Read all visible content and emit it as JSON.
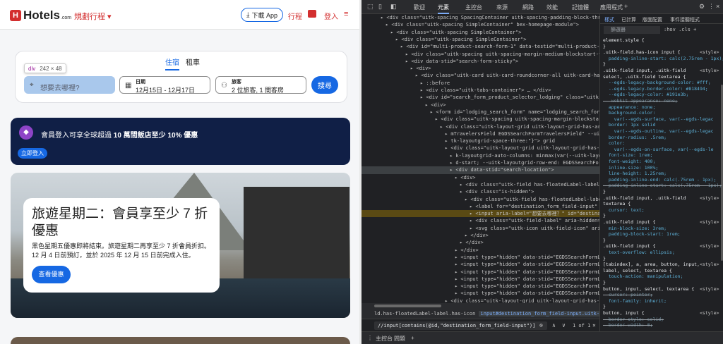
{
  "site": {
    "logo_mark": "H",
    "logo_text": "Hotels",
    "logo_suffix": ".com",
    "trip_label": "規劃行程 ▾",
    "app_button": "下載 App",
    "nav_trips": "行程",
    "nav_login": "登入",
    "tabs": [
      "住宿",
      "租車"
    ],
    "tooltip": {
      "tag": "div",
      "dims": "242 × 48"
    },
    "destination": {
      "placeholder": "想要去哪裡?"
    },
    "dates": {
      "label": "日期",
      "value": "12月15日 - 12月17日"
    },
    "travelers": {
      "label": "旅客",
      "value": "2 位旅客, 1 間客房"
    },
    "search_button": "搜尋",
    "promo": {
      "text_before": "會員登入可享全球超過 ",
      "bold1": "10 萬間飯店至少 10% 優惠",
      "button": "立即登入"
    },
    "hero": {
      "title": "旅遊星期二：會員享至少 7 折優惠",
      "description": "黑色星期五優惠即將結束。旅遊星期二再享至少 7 折會員折扣。12 月 4 日前預訂，並於 2025 年 12 月 15 日前完成入住。",
      "button": "查看優惠"
    }
  },
  "devtools": {
    "tabs": [
      "歡迎",
      "元素",
      "主控台",
      "來源",
      "網路",
      "效能",
      "記憶體",
      "應用程式"
    ],
    "active_tab": "元素",
    "elements": [
      {
        "i": 5,
        "t": "<div class=\"uitk-spacing SpacingContainer uitk-spacing-padding-block-three uitk"
      },
      {
        "i": 6,
        "t": "<div class=\"uitk-spacing SimpleContainer\" bex-homepage-module\">"
      },
      {
        "i": 7,
        "t": "<div class=\"uitk-spacing SimpleContainer\">"
      },
      {
        "i": 8,
        "t": "<div class=\"uitk-spacing SimpleContainer\">"
      },
      {
        "i": 9,
        "t": "<div id=\"multi-product-search-form-1\" data-testid=\"multi-product-search"
      },
      {
        "i": 10,
        "t": "<div class=\"uitk-spacing uitk-spacing-margin-medium-blockstart-twelve"
      },
      {
        "i": 10,
        "t": "<div data-stid=\"search-form-sticky\">"
      },
      {
        "i": 11,
        "t": "<div>"
      },
      {
        "i": 12,
        "t": "<div class=\"uitk-card uitk-card-roundcorner-all uitk-card-has-bo"
      },
      {
        "i": 13,
        "t": "::before"
      },
      {
        "i": 13,
        "t": "<div class=\"uitk-tabs-container\"> … </div>"
      },
      {
        "i": 13,
        "t": "<div id=\"search_form_product_selector_lodging\" class=\"uitk-spa"
      },
      {
        "i": 14,
        "t": "<div>"
      },
      {
        "i": 15,
        "t": "<form id=\"lodging_search_form\" name=\"lodging_search_form\" …"
      },
      {
        "i": 16,
        "t": "<div class=\"uitk-spacing uitk-spacing-margin-blockstart-"
      },
      {
        "i": 17,
        "t": "<div class=\"uitk-layout-grid uitk-layout-grid-has-areas"
      },
      {
        "i": 18,
        "t": "mTravelersField EGDSSearchFormTravelersField\" --uitk-layoutgr"
      },
      {
        "i": 18,
        "t": "tk-layoutgrid-space-three:\"}\"> grid"
      },
      {
        "i": 18,
        "t": "<div class=\"uitk-layout-grid uitk-layout-grid-has-aut"
      },
      {
        "i": 19,
        "t": "k-layoutgrid-auto-columns: minmax(var(--uitk-layoutgr"
      },
      {
        "i": 19,
        "t": "d-start; --uitk-layoutgrid-row-end: EGDSSearchFormLoca"
      },
      {
        "i": 19,
        "t": "<div data-stid=\"search-location\">",
        "sel": true
      },
      {
        "i": 20,
        "t": "<div>"
      },
      {
        "i": 21,
        "t": "<div class=\"uitk-field has-floatedLabel-label has"
      },
      {
        "i": 21,
        "t": "<div class=\"is-hidden\">"
      },
      {
        "i": 22,
        "t": "<div class=\"uitk-field has-floatedLabel-label"
      },
      {
        "i": 23,
        "t": "<label for=\"destination_form_field-input\" cl"
      },
      {
        "i": 23,
        "t": "<input aria-label=\"想要去哪裡？\" id=\"destinati",
        "hl": true
      },
      {
        "i": 23,
        "t": "<div class=\"uitk-field-label\" aria-hidden=\"tr"
      },
      {
        "i": 23,
        "t": "<svg class=\"uitk-icon uitk-field-icon\" aria-"
      },
      {
        "i": 22,
        "t": "</div>"
      },
      {
        "i": 21,
        "t": "</div>"
      },
      {
        "i": 20,
        "t": "</div>"
      },
      {
        "i": 20,
        "t": "<input type=\"hidden\" data-stid=\"EGDSSearchFormLocati"
      },
      {
        "i": 20,
        "t": "<input type=\"hidden\" data-stid=\"EGDSSearchFormLocati"
      },
      {
        "i": 20,
        "t": "<input type=\"hidden\" data-stid=\"EGDSSearchFormLocati"
      },
      {
        "i": 20,
        "t": "<input type=\"hidden\" data-stid=\"EGDSSearchFormLocati"
      },
      {
        "i": 20,
        "t": "<input type=\"hidden\" data-stid=\"EGDSSearchFormLocati"
      },
      {
        "i": 20,
        "t": "<input type=\"hidden\" data-stid=\"EGDSSearchFormLocati"
      },
      {
        "i": 18,
        "t": "<div class=\"uitk-layout-grid uitk-layout-grid-has-aut"
      },
      {
        "i": 19,
        "t": "k-layoutgrid-auto-columns: minmax(var(--uitk-layoutgr"
      },
      {
        "i": 19,
        "t": "erField-start; --uitk-layoutgrid-row-end: EGDSSearchFo"
      },
      {
        "i": 18,
        "t": "<div class=\"uitk-layout-grid uitk-layout-grid-has-aut"
      }
    ],
    "breadcrumbs": {
      "a": "ld.has-floatedLabel-label.has-icon",
      "b": "input#destination_form_field-input.uitk-field-input.empty-placeholder"
    },
    "find": {
      "query": "//input[contains(@id,\"destination_form_field-input\")]",
      "count": "1 of 1"
    },
    "drawer_tabs": [
      "主控台",
      "問題"
    ],
    "styles_tabs": [
      "樣式",
      "已計算",
      "版面配置",
      "事件接聽程式"
    ],
    "filter_placeholder": "篩選器",
    "filter_tools": ":hov .cls +",
    "styles": [
      {
        "t": "element.style {",
        "k": "sel"
      },
      {
        "t": "}",
        "k": "sel"
      },
      {
        "t": ".uitk-field.has-icon input {",
        "k": "sel",
        "src": "<style>"
      },
      {
        "t": "  padding-inline-start: calc(2.75rem - 1px);",
        "k": "prop"
      },
      {
        "t": "}",
        "k": "sel"
      },
      {
        "t": ".uitk-field input, .uitk-field",
        "k": "sel",
        "src": "<style>"
      },
      {
        "t": "select, .uitk-field textarea {",
        "k": "sel"
      },
      {
        "t": "  --egds-legacy-background-color: #fff;",
        "k": "prop"
      },
      {
        "t": "  --egds-legacy-border-color: #818494;",
        "k": "prop"
      },
      {
        "t": "  --egds-legacy-color: #191e3b;",
        "k": "prop"
      },
      {
        "t": "  -webkit-appearance: none;",
        "k": "strike"
      },
      {
        "t": "  appearance: none;",
        "k": "prop"
      },
      {
        "t": "  background-color:",
        "k": "prop"
      },
      {
        "t": "    var(--egds-surface, var(--egds-legac",
        "k": "prop"
      },
      {
        "t": "  border: 1px solid",
        "k": "prop"
      },
      {
        "t": "    var(--egds-outline, var(--egds-legac",
        "k": "prop"
      },
      {
        "t": "  border-radius: .5rem;",
        "k": "prop"
      },
      {
        "t": "  color:",
        "k": "prop"
      },
      {
        "t": "    var(--egds-on-surface, var(--egds-le",
        "k": "prop"
      },
      {
        "t": "  font-size: 1rem;",
        "k": "prop"
      },
      {
        "t": "  font-weight: 400;",
        "k": "prop"
      },
      {
        "t": "  inline-size: 100%;",
        "k": "prop"
      },
      {
        "t": "  line-height: 1.25rem;",
        "k": "prop"
      },
      {
        "t": "  padding-inline-end: calc(.75rem - 1px);",
        "k": "prop"
      },
      {
        "t": "  padding-inline-start: calc(.75rem - 1px);",
        "k": "strike"
      },
      {
        "t": "}",
        "k": "sel"
      },
      {
        "t": ".uitk-field input, .uitk-field",
        "k": "sel",
        "src": "<style>"
      },
      {
        "t": "textarea {",
        "k": "sel"
      },
      {
        "t": "  cursor: text;",
        "k": "prop"
      },
      {
        "t": "}",
        "k": "sel"
      },
      {
        "t": ".uitk-field input {",
        "k": "sel",
        "src": "<style>"
      },
      {
        "t": "  min-block-size: 3rem;",
        "k": "prop"
      },
      {
        "t": "  padding-block-start: 1rem;",
        "k": "prop"
      },
      {
        "t": "}",
        "k": "sel"
      },
      {
        "t": ".uitk-field input {",
        "k": "sel",
        "src": "<style>"
      },
      {
        "t": "  text-overflow: ellipsis;",
        "k": "prop"
      },
      {
        "t": "}",
        "k": "sel"
      },
      {
        "t": "[tabindex], a, area, button, input,",
        "k": "sel",
        "src": "<style>"
      },
      {
        "t": "label, select, textarea {",
        "k": "sel"
      },
      {
        "t": "  touch-action: manipulation;",
        "k": "prop"
      },
      {
        "t": "}",
        "k": "sel"
      },
      {
        "t": "button, input, select, textarea {",
        "k": "sel",
        "src": "<style>"
      },
      {
        "t": "  cursor: pointer;",
        "k": "strike"
      },
      {
        "t": "  font-family: inherit;",
        "k": "prop"
      },
      {
        "t": "}",
        "k": "sel"
      },
      {
        "t": "button, input {",
        "k": "sel",
        "src": "<style>"
      },
      {
        "t": "  border-style: solid;",
        "k": "strike"
      },
      {
        "t": "  border-width: 0;",
        "k": "strike"
      }
    ]
  }
}
